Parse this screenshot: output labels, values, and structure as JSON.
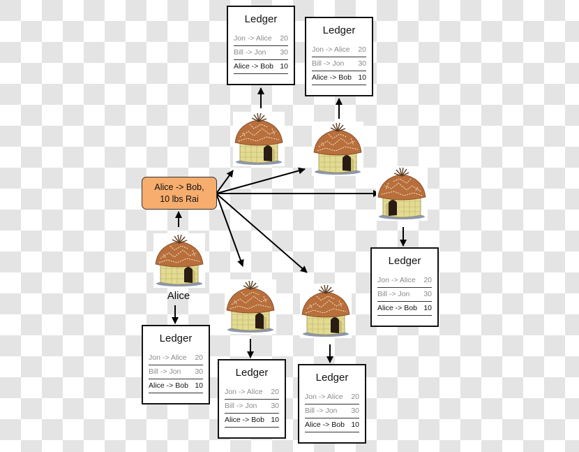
{
  "transaction": {
    "line1": "Alice -> Bob,",
    "line2": "10 lbs Rai",
    "color": "#f7ad6d"
  },
  "alice_label": "Alice",
  "ledger": {
    "title": "Ledger",
    "rows": [
      {
        "entry": "Jon -> Alice",
        "amount": "20",
        "status": "confirmed"
      },
      {
        "entry": "Bill -> Jon",
        "amount": "30",
        "status": "confirmed"
      },
      {
        "entry": "Alice -> Bob",
        "amount": "10",
        "status": "new"
      }
    ]
  },
  "nodes": [
    {
      "id": "alice",
      "icon": "hut-icon"
    },
    {
      "id": "villager-1",
      "icon": "hut-icon"
    },
    {
      "id": "villager-2",
      "icon": "hut-icon"
    },
    {
      "id": "villager-3",
      "icon": "hut-icon"
    },
    {
      "id": "villager-4",
      "icon": "hut-icon"
    },
    {
      "id": "villager-5",
      "icon": "hut-icon"
    }
  ],
  "colors": {
    "roof": "#b86f3b",
    "wall": "#e3db93",
    "door": "#2a1c12",
    "border": "#111111",
    "old_entry_text": "#8a8a8a"
  }
}
